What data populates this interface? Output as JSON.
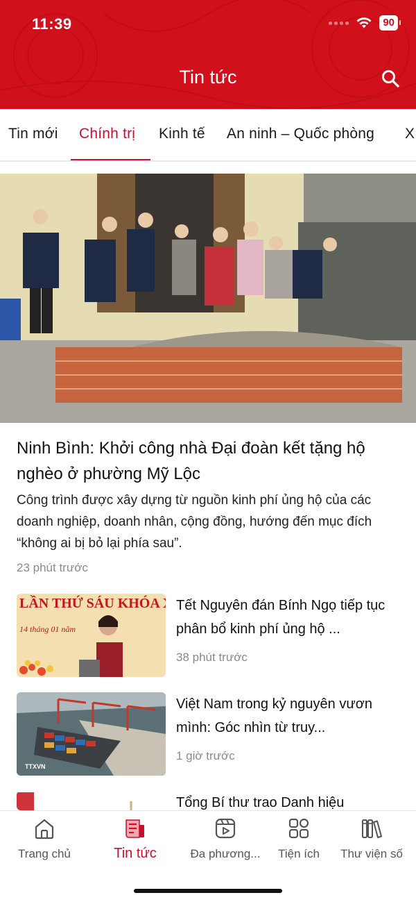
{
  "status_bar": {
    "time": "11:39",
    "battery": "90"
  },
  "header": {
    "title": "Tin tức",
    "search_icon": "search-icon",
    "color": "#d0111b"
  },
  "tabs": [
    {
      "label": "Tin mới",
      "active": false
    },
    {
      "label": "Chính trị",
      "active": true
    },
    {
      "label": "Kinh tế",
      "active": false
    },
    {
      "label": "An ninh – Quốc phòng",
      "active": false
    },
    {
      "label": "X",
      "active": false
    }
  ],
  "featured": {
    "title": "Ninh Bình: Khởi công nhà Đại đoàn kết tặng hộ nghèo ở phường Mỹ Lộc",
    "summary": "Công trình được xây dựng từ nguồn kinh phí ủng hộ của các doanh nghiệp, doanh nhân, cộng đồng, hướng đến mục đích “không ai bị bỏ lại phía sau”.",
    "time": "23 phút trước"
  },
  "articles": [
    {
      "title": "Tết Nguyên đán Bính Ngọ tiếp tục phân bổ kinh phí ủng hộ ...",
      "time": "38 phút trước",
      "thumb_text": "LẦN THỨ SÁU KHÓA X",
      "thumb_subtext": "14 tháng 01 năm"
    },
    {
      "title": "Việt Nam trong kỷ nguyên vươn mình: Góc nhìn từ truy...",
      "time": "1 giờ trước",
      "thumb_text": "TTXVN"
    },
    {
      "title": "Tổng Bí thư trao Danh hiệu",
      "time": ""
    }
  ],
  "bottom_nav": [
    {
      "label": "Trang chủ",
      "icon": "home-icon",
      "active": false
    },
    {
      "label": "Tin tức",
      "icon": "news-icon",
      "active": true
    },
    {
      "label": "Đa phương...",
      "icon": "multimedia-icon",
      "active": false
    },
    {
      "label": "Tiện ích",
      "icon": "grid-icon",
      "active": false
    },
    {
      "label": "Thư viện số",
      "icon": "library-icon",
      "active": false
    }
  ],
  "accent_color": "#c8102e"
}
